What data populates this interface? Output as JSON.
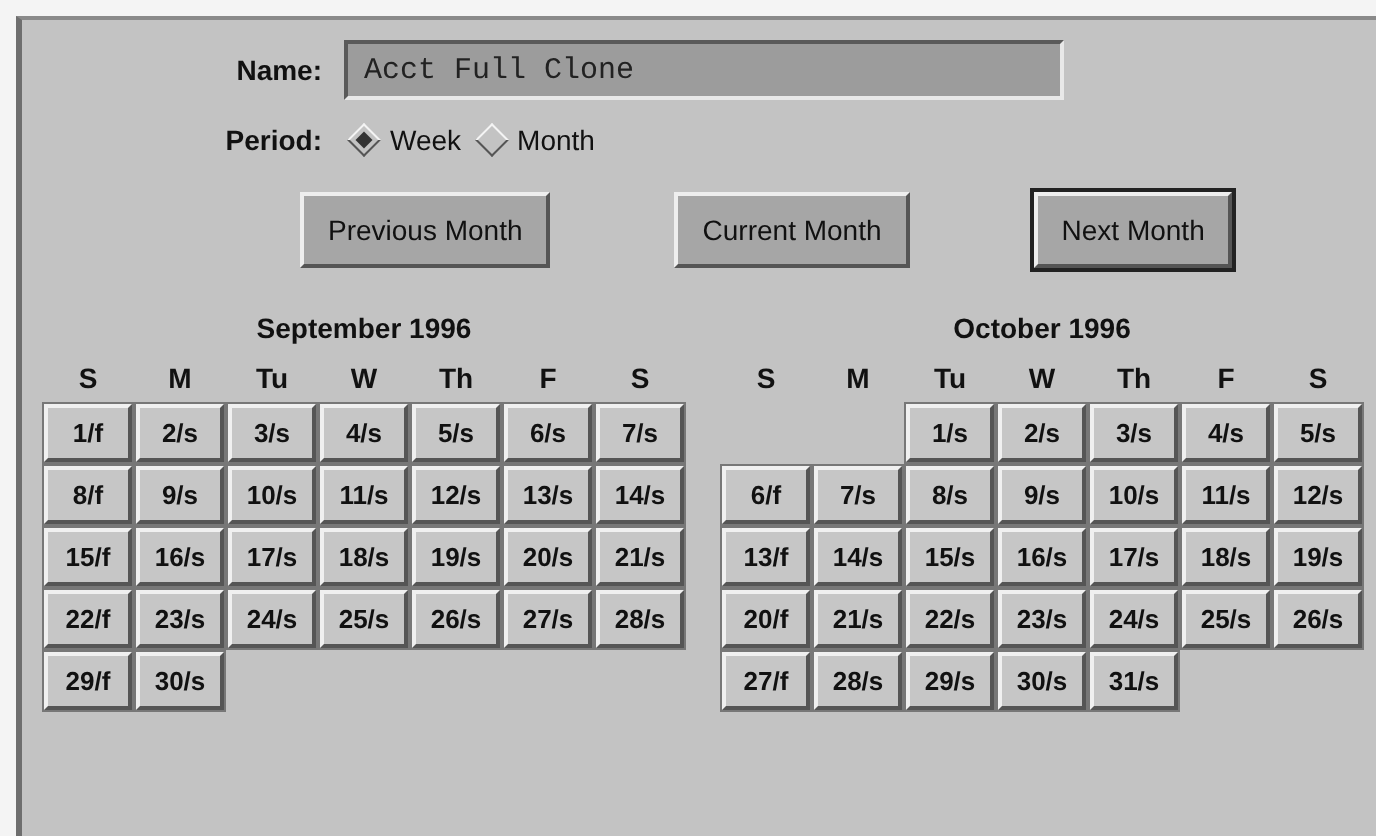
{
  "name_field": {
    "label": "Name:",
    "value": "Acct Full Clone"
  },
  "period": {
    "label": "Period:",
    "options": [
      {
        "label": "Week",
        "selected": true
      },
      {
        "label": "Month",
        "selected": false
      }
    ]
  },
  "buttons": [
    {
      "label": "Previous Month",
      "default": false
    },
    {
      "label": "Current Month",
      "default": false
    },
    {
      "label": "Next Month",
      "default": true
    }
  ],
  "calendars": [
    {
      "title": "September 1996",
      "weekdays": [
        "S",
        "M",
        "Tu",
        "W",
        "Th",
        "F",
        "S"
      ],
      "weeks": [
        [
          {
            "kind": "day",
            "label": "1/f"
          },
          {
            "kind": "day",
            "label": "2/s"
          },
          {
            "kind": "day",
            "label": "3/s"
          },
          {
            "kind": "day",
            "label": "4/s"
          },
          {
            "kind": "day",
            "label": "5/s"
          },
          {
            "kind": "day",
            "label": "6/s"
          },
          {
            "kind": "day",
            "label": "7/s"
          }
        ],
        [
          {
            "kind": "day",
            "label": "8/f"
          },
          {
            "kind": "day",
            "label": "9/s"
          },
          {
            "kind": "day",
            "label": "10/s"
          },
          {
            "kind": "day",
            "label": "11/s"
          },
          {
            "kind": "day",
            "label": "12/s"
          },
          {
            "kind": "day",
            "label": "13/s"
          },
          {
            "kind": "day",
            "label": "14/s"
          }
        ],
        [
          {
            "kind": "day",
            "label": "15/f"
          },
          {
            "kind": "day",
            "label": "16/s"
          },
          {
            "kind": "day",
            "label": "17/s"
          },
          {
            "kind": "day",
            "label": "18/s"
          },
          {
            "kind": "day",
            "label": "19/s"
          },
          {
            "kind": "day",
            "label": "20/s"
          },
          {
            "kind": "day",
            "label": "21/s"
          }
        ],
        [
          {
            "kind": "day",
            "label": "22/f"
          },
          {
            "kind": "day",
            "label": "23/s"
          },
          {
            "kind": "day",
            "label": "24/s"
          },
          {
            "kind": "day",
            "label": "25/s"
          },
          {
            "kind": "day",
            "label": "26/s"
          },
          {
            "kind": "day",
            "label": "27/s"
          },
          {
            "kind": "day",
            "label": "28/s"
          }
        ],
        [
          {
            "kind": "day",
            "label": "29/f"
          },
          {
            "kind": "day",
            "label": "30/s"
          },
          {
            "kind": "blank"
          },
          {
            "kind": "blank"
          },
          {
            "kind": "blank"
          },
          {
            "kind": "blank"
          },
          {
            "kind": "blank"
          }
        ]
      ]
    },
    {
      "title": "October 1996",
      "weekdays": [
        "S",
        "M",
        "Tu",
        "W",
        "Th",
        "F",
        "S"
      ],
      "weeks": [
        [
          {
            "kind": "blank"
          },
          {
            "kind": "blank"
          },
          {
            "kind": "day",
            "label": "1/s"
          },
          {
            "kind": "day",
            "label": "2/s"
          },
          {
            "kind": "day",
            "label": "3/s"
          },
          {
            "kind": "day",
            "label": "4/s"
          },
          {
            "kind": "day",
            "label": "5/s"
          }
        ],
        [
          {
            "kind": "day",
            "label": "6/f"
          },
          {
            "kind": "day",
            "label": "7/s"
          },
          {
            "kind": "day",
            "label": "8/s"
          },
          {
            "kind": "day",
            "label": "9/s"
          },
          {
            "kind": "day",
            "label": "10/s"
          },
          {
            "kind": "day",
            "label": "11/s"
          },
          {
            "kind": "day",
            "label": "12/s"
          }
        ],
        [
          {
            "kind": "day",
            "label": "13/f"
          },
          {
            "kind": "day",
            "label": "14/s"
          },
          {
            "kind": "day",
            "label": "15/s"
          },
          {
            "kind": "day",
            "label": "16/s"
          },
          {
            "kind": "day",
            "label": "17/s"
          },
          {
            "kind": "day",
            "label": "18/s"
          },
          {
            "kind": "day",
            "label": "19/s"
          }
        ],
        [
          {
            "kind": "day",
            "label": "20/f"
          },
          {
            "kind": "day",
            "label": "21/s"
          },
          {
            "kind": "day",
            "label": "22/s"
          },
          {
            "kind": "day",
            "label": "23/s"
          },
          {
            "kind": "day",
            "label": "24/s"
          },
          {
            "kind": "day",
            "label": "25/s"
          },
          {
            "kind": "day",
            "label": "26/s"
          }
        ],
        [
          {
            "kind": "day",
            "label": "27/f"
          },
          {
            "kind": "day",
            "label": "28/s"
          },
          {
            "kind": "day",
            "label": "29/s"
          },
          {
            "kind": "day",
            "label": "30/s"
          },
          {
            "kind": "day",
            "label": "31/s"
          },
          {
            "kind": "blank"
          },
          {
            "kind": "blank"
          }
        ]
      ]
    }
  ]
}
